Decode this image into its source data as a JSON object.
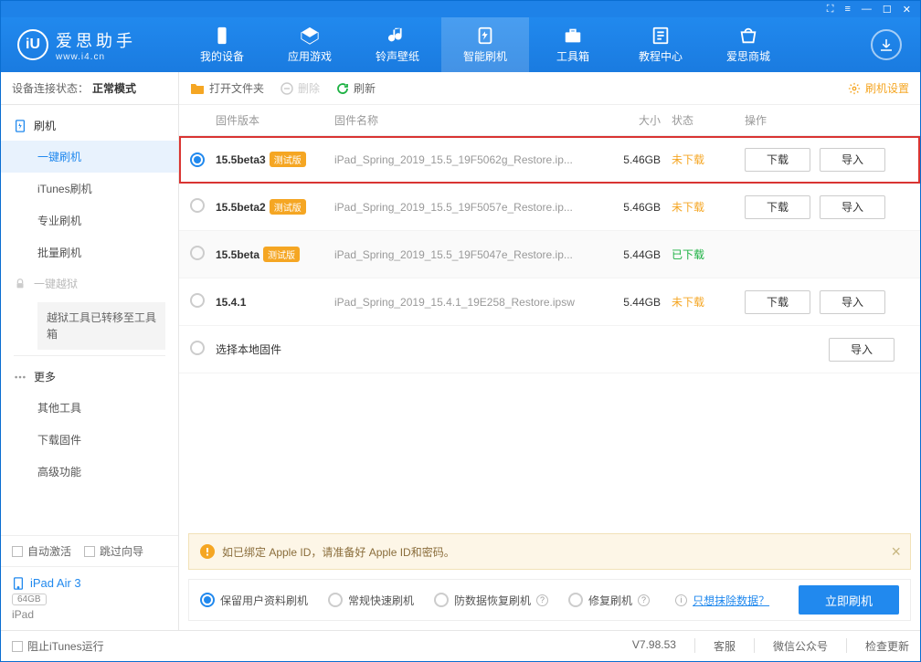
{
  "titlebar": {
    "icons": [
      "⛶",
      "≡",
      "—",
      "☐",
      "✕"
    ]
  },
  "brand": {
    "title": "爱思助手",
    "sub": "www.i4.cn",
    "logo": "iU"
  },
  "navs": [
    {
      "label": "我的设备"
    },
    {
      "label": "应用游戏"
    },
    {
      "label": "铃声壁纸"
    },
    {
      "label": "智能刷机",
      "active": true
    },
    {
      "label": "工具箱"
    },
    {
      "label": "教程中心"
    },
    {
      "label": "爱思商城"
    }
  ],
  "status": {
    "label": "设备连接状态：",
    "value": "正常模式"
  },
  "side": {
    "flash": {
      "head": "刷机",
      "items": [
        "一键刷机",
        "iTunes刷机",
        "专业刷机",
        "批量刷机"
      ],
      "activeIndex": 0
    },
    "jailbreak": {
      "head": "一键越狱",
      "note": "越狱工具已转移至工具箱"
    },
    "more": {
      "head": "更多",
      "items": [
        "其他工具",
        "下载固件",
        "高级功能"
      ]
    }
  },
  "checks": {
    "autoActivate": "自动激活",
    "skipGuide": "跳过向导"
  },
  "device": {
    "name": "iPad Air 3",
    "storage": "64GB",
    "model": "iPad"
  },
  "toolbar": {
    "openFolder": "打开文件夹",
    "delete": "删除",
    "refresh": "刷新",
    "settings": "刷机设置"
  },
  "thead": {
    "version": "固件版本",
    "name": "固件名称",
    "size": "大小",
    "status": "状态",
    "ops": "操作"
  },
  "rows": [
    {
      "selected": true,
      "highlight": true,
      "version": "15.5beta3",
      "beta": "测试版",
      "file": "iPad_Spring_2019_15.5_19F5062g_Restore.ip...",
      "size": "5.46GB",
      "status": "未下载",
      "statusClass": "st-no",
      "btns": [
        "下载",
        "导入"
      ]
    },
    {
      "selected": false,
      "version": "15.5beta2",
      "beta": "测试版",
      "file": "iPad_Spring_2019_15.5_19F5057e_Restore.ip...",
      "size": "5.46GB",
      "status": "未下载",
      "statusClass": "st-no",
      "btns": [
        "下载",
        "导入"
      ]
    },
    {
      "selected": false,
      "alt": true,
      "version": "15.5beta",
      "beta": "测试版",
      "file": "iPad_Spring_2019_15.5_19F5047e_Restore.ip...",
      "size": "5.44GB",
      "status": "已下载",
      "statusClass": "st-yes",
      "btns": []
    },
    {
      "selected": false,
      "version": "15.4.1",
      "beta": "",
      "file": "iPad_Spring_2019_15.4.1_19E258_Restore.ipsw",
      "size": "5.44GB",
      "status": "未下载",
      "statusClass": "st-no",
      "btns": [
        "下载",
        "导入"
      ]
    },
    {
      "selected": false,
      "local": true,
      "version": "选择本地固件",
      "file": "",
      "size": "",
      "status": "",
      "btns": [
        "导入"
      ]
    }
  ],
  "notice": {
    "text": "如已绑定 Apple ID，请准备好 Apple ID和密码。"
  },
  "opts": {
    "keepData": "保留用户资料刷机",
    "normal": "常规快速刷机",
    "antiRecovery": "防数据恢复刷机",
    "repair": "修复刷机",
    "eraseLink": "只想抹除数据？",
    "go": "立即刷机"
  },
  "footer": {
    "blockItunes": "阻止iTunes运行",
    "version": "V7.98.53",
    "links": [
      "客服",
      "微信公众号",
      "检查更新"
    ]
  }
}
